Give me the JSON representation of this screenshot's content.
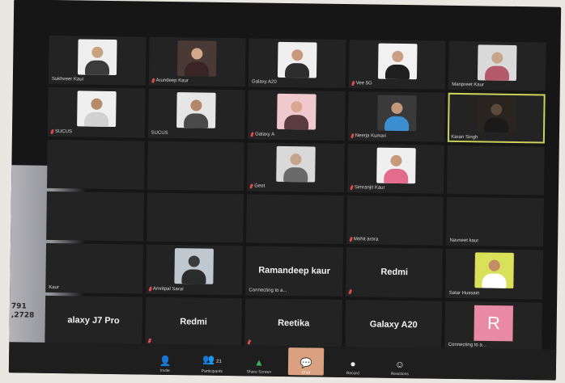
{
  "edge_text": [
    "791",
    ",2728"
  ],
  "tiles": [
    {
      "id": "t1",
      "type": "video",
      "label": "Sukhveer Kaur",
      "muted": false,
      "bg": "#eeeeee",
      "skin": "#c9a27e",
      "cloth": "#3b3b3b"
    },
    {
      "id": "t2",
      "type": "video",
      "label": "Arundeep Kaur",
      "muted": true,
      "bg": "#4a3a35",
      "skin": "#d4a98a",
      "cloth": "#3a2525"
    },
    {
      "id": "t3",
      "type": "video",
      "label": "Galaxy A20",
      "muted": false,
      "bg": "#efefef",
      "skin": "#c8997a",
      "cloth": "#2d2d2d"
    },
    {
      "id": "t4",
      "type": "video",
      "label": "Vee 5G",
      "muted": true,
      "bg": "#f1f1f1",
      "skin": "#caa083",
      "cloth": "#1f1f1f"
    },
    {
      "id": "t5",
      "type": "video",
      "label": "Manpreet Kaur",
      "muted": false,
      "bg": "#dadada",
      "skin": "#c9a48a",
      "cloth": "#b35b6b"
    },
    {
      "id": "t6",
      "type": "video",
      "label": "SUCUS",
      "muted": true,
      "bg": "#efefef",
      "skin": "#b78a6a",
      "cloth": "#d1d1d1"
    },
    {
      "id": "t7",
      "type": "video",
      "label": "SUCUS",
      "muted": false,
      "bg": "#e6e6e6",
      "skin": "#b6866a",
      "cloth": "#4a4a4a"
    },
    {
      "id": "t8",
      "type": "video",
      "label": "Galaxy A",
      "muted": true,
      "bg": "#f0c9cf",
      "skin": "#d9a78e",
      "cloth": "#5a3b40"
    },
    {
      "id": "t9",
      "type": "video",
      "label": "Neerja Kumari",
      "muted": true,
      "bg": "#3a3a3a",
      "skin": "#c59779",
      "cloth": "#3b8fd0"
    },
    {
      "id": "t10",
      "type": "video",
      "label": "Karan Singh",
      "muted": false,
      "bg": "#2a2420",
      "skin": "#5a4a3a",
      "cloth": "#1a1a1a",
      "active": true
    },
    {
      "id": "t11",
      "type": "empty",
      "label": "",
      "muted": false
    },
    {
      "id": "t12",
      "type": "empty",
      "label": "",
      "muted": false
    },
    {
      "id": "t13",
      "type": "video",
      "label": "Geet",
      "muted": true,
      "bg": "#d9d9d9",
      "skin": "#c6a48c",
      "cloth": "#6a6a6a"
    },
    {
      "id": "t14",
      "type": "video",
      "label": "Simranjit Kaur",
      "muted": true,
      "bg": "#efefef",
      "skin": "#c99a7a",
      "cloth": "#e36c8c"
    },
    {
      "id": "t15",
      "type": "empty",
      "label": "",
      "muted": false
    },
    {
      "id": "t16",
      "type": "empty",
      "label": "",
      "muted": false
    },
    {
      "id": "t17",
      "type": "empty",
      "label": "",
      "muted": false
    },
    {
      "id": "t18",
      "type": "empty",
      "label": "",
      "muted": false
    },
    {
      "id": "t19",
      "type": "name",
      "label": "Mohit arora",
      "muted": true,
      "name": ""
    },
    {
      "id": "t20",
      "type": "name",
      "label": "Navneet kaur",
      "muted": false,
      "name": ""
    },
    {
      "id": "t21",
      "type": "empty",
      "label": "Kaur",
      "muted": false
    },
    {
      "id": "t22",
      "type": "video",
      "label": "Amritpal Sarai",
      "muted": true,
      "bg": "#bfc7cf",
      "skin": "#3a3a3a",
      "cloth": "#2b2b2b"
    },
    {
      "id": "t23",
      "type": "name",
      "label": "Connecting to a...",
      "muted": false,
      "name": "Ramandeep kaur"
    },
    {
      "id": "t24",
      "type": "name",
      "label": "",
      "muted": true,
      "name": "Redmi"
    },
    {
      "id": "t25",
      "type": "video",
      "label": "Satar Hussain",
      "muted": false,
      "bg": "#d9e05a",
      "skin": "#c58a66",
      "cloth": "#ffffff"
    },
    {
      "id": "t26",
      "type": "name",
      "label": "",
      "muted": false,
      "name": "alaxy J7 Pro"
    },
    {
      "id": "t27",
      "type": "name",
      "label": "",
      "muted": true,
      "name": "Redmi"
    },
    {
      "id": "t28",
      "type": "name",
      "label": "",
      "muted": true,
      "name": "Reetika"
    },
    {
      "id": "t29",
      "type": "name",
      "label": "",
      "muted": false,
      "name": "Galaxy A20"
    },
    {
      "id": "t30",
      "type": "avatar",
      "label": "Connecting to a...",
      "muted": false,
      "letter": "R"
    }
  ],
  "toolbar": [
    {
      "id": "invite",
      "label": "Invite",
      "icon": "person-plus-icon",
      "glyph": "👤",
      "extra": ""
    },
    {
      "id": "participants",
      "label": "Participants",
      "icon": "people-icon",
      "glyph": "👥",
      "extra": "21"
    },
    {
      "id": "share",
      "label": "Share Screen",
      "icon": "share-screen-icon",
      "glyph": "▲",
      "extra": ""
    },
    {
      "id": "chat",
      "label": "Chat",
      "icon": "chat-icon",
      "glyph": "💬",
      "extra": ""
    },
    {
      "id": "record",
      "label": "Record",
      "icon": "record-icon",
      "glyph": "●",
      "extra": ""
    },
    {
      "id": "reactions",
      "label": "Reactions",
      "icon": "reactions-icon",
      "glyph": "☺",
      "extra": ""
    }
  ]
}
